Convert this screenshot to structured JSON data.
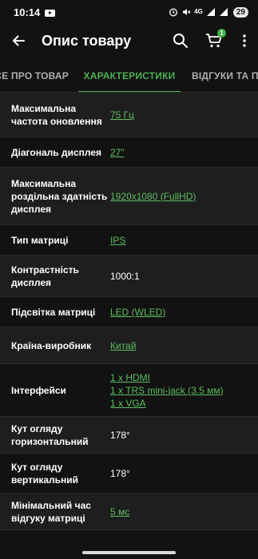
{
  "status": {
    "time": "10:14",
    "network": "4G",
    "battery": "29"
  },
  "header": {
    "title": "Опис товару",
    "cart_count": "1"
  },
  "tabs": [
    {
      "label": "СЕ ПРО ТОВАР"
    },
    {
      "label": "ХАРАКТЕРИСТИКИ"
    },
    {
      "label": "ВІДГУКИ ТА П"
    }
  ],
  "specs": [
    {
      "label": "Максимальна частота оновлення",
      "value": "75 Гц",
      "link": true
    },
    {
      "label": "Діагональ дисплея",
      "value": "27\"",
      "link": true
    },
    {
      "label": "Максимальна роздільна здатність дисплея",
      "value": "1920x1080 (FullHD)",
      "link": true
    },
    {
      "label": "Тип матриці",
      "value": "IPS",
      "link": true
    },
    {
      "label": "Контрастність дисплея",
      "value": "1000:1",
      "link": false
    },
    {
      "label": "Підсвітка матриці",
      "value": "LED (WLED)",
      "link": true
    },
    {
      "label": "Країна-виробник",
      "value": "Китай",
      "link": true
    },
    {
      "label": "Інтерфейси",
      "values": [
        "1 x HDMI",
        "1 x TRS mini-jack (3.5 мм)",
        "1 x VGA"
      ],
      "link": true
    },
    {
      "label": "Кут огляду горизонтальний",
      "value": "178°",
      "link": false
    },
    {
      "label": "Кут огляду вертикальний",
      "value": "178°",
      "link": false
    },
    {
      "label": "Мінімальний час відгуку матриці",
      "value": "5 мс",
      "link": true
    }
  ]
}
